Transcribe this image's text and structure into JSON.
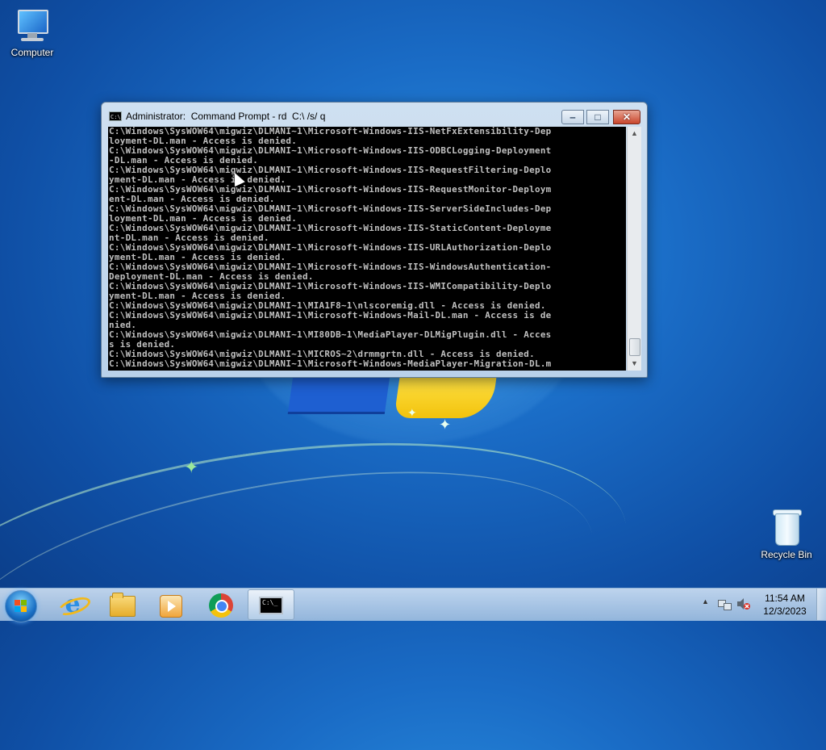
{
  "desktop": {
    "icons": [
      {
        "label": "Computer",
        "icon": "computer-icon"
      },
      {
        "label": "Recycle Bin",
        "icon": "recycle-bin-icon"
      }
    ]
  },
  "cmd_window": {
    "title": "Administrator:  Command Prompt - rd  C:\\ /s/ q",
    "buttons": {
      "minimize": "‒",
      "maximize": "□",
      "close": "✕"
    },
    "console_lines": [
      "C:\\Windows\\SysWOW64\\migwiz\\DLMANI~1\\Microsoft-Windows-IIS-NetFxExtensibility-Dep",
      "loyment-DL.man - Access is denied.",
      "C:\\Windows\\SysWOW64\\migwiz\\DLMANI~1\\Microsoft-Windows-IIS-ODBCLogging-Deployment",
      "-DL.man - Access is denied.",
      "C:\\Windows\\SysWOW64\\migwiz\\DLMANI~1\\Microsoft-Windows-IIS-RequestFiltering-Deplo",
      "yment-DL.man - Access is denied.",
      "C:\\Windows\\SysWOW64\\migwiz\\DLMANI~1\\Microsoft-Windows-IIS-RequestMonitor-Deploym",
      "ent-DL.man - Access is denied.",
      "C:\\Windows\\SysWOW64\\migwiz\\DLMANI~1\\Microsoft-Windows-IIS-ServerSideIncludes-Dep",
      "loyment-DL.man - Access is denied.",
      "C:\\Windows\\SysWOW64\\migwiz\\DLMANI~1\\Microsoft-Windows-IIS-StaticContent-Deployme",
      "nt-DL.man - Access is denied.",
      "C:\\Windows\\SysWOW64\\migwiz\\DLMANI~1\\Microsoft-Windows-IIS-URLAuthorization-Deplo",
      "yment-DL.man - Access is denied.",
      "C:\\Windows\\SysWOW64\\migwiz\\DLMANI~1\\Microsoft-Windows-IIS-WindowsAuthentication-",
      "Deployment-DL.man - Access is denied.",
      "C:\\Windows\\SysWOW64\\migwiz\\DLMANI~1\\Microsoft-Windows-IIS-WMICompatibility-Deplo",
      "yment-DL.man - Access is denied.",
      "C:\\Windows\\SysWOW64\\migwiz\\DLMANI~1\\MIA1F8~1\\nlscoremig.dll - Access is denied.",
      "C:\\Windows\\SysWOW64\\migwiz\\DLMANI~1\\Microsoft-Windows-Mail-DL.man - Access is de",
      "nied.",
      "C:\\Windows\\SysWOW64\\migwiz\\DLMANI~1\\MI80DB~1\\MediaPlayer-DLMigPlugin.dll - Acces",
      "s is denied.",
      "C:\\Windows\\SysWOW64\\migwiz\\DLMANI~1\\MICROS~2\\drmmgrtn.dll - Access is denied.",
      "C:\\Windows\\SysWOW64\\migwiz\\DLMANI~1\\Microsoft-Windows-MediaPlayer-Migration-DL.m"
    ]
  },
  "taskbar": {
    "start": "start-orb",
    "pinned": [
      {
        "name": "internet-explorer",
        "icon": "internet-explorer-icon"
      },
      {
        "name": "file-explorer",
        "icon": "folder-icon"
      },
      {
        "name": "media-player",
        "icon": "media-player-icon"
      },
      {
        "name": "chrome",
        "icon": "chrome-icon"
      },
      {
        "name": "command-prompt",
        "icon": "command-prompt-icon",
        "active": true
      }
    ],
    "tray": {
      "show_hidden_arrow": "▲",
      "clock_time": "11:54 AM",
      "clock_date": "12/3/2023"
    }
  }
}
